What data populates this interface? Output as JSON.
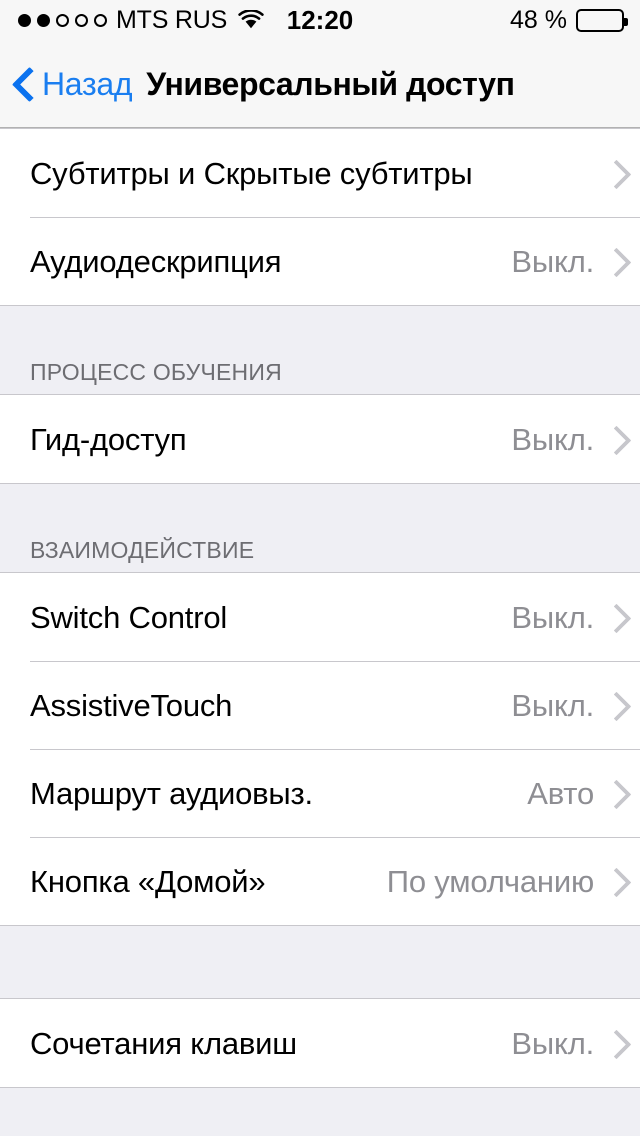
{
  "status_bar": {
    "signal_dots_total": 5,
    "signal_dots_filled": 2,
    "carrier": "MTS RUS",
    "wifi_icon": "wifi-icon",
    "time": "12:20",
    "battery_percent_label": "48 %",
    "battery_level": 48
  },
  "nav": {
    "back_label": "Назад",
    "back_icon": "chevron-left-icon",
    "title": "Универсальный доступ"
  },
  "colors": {
    "tint_blue": "#1a7ef0",
    "group_background": "#ffffff",
    "page_background": "#efeff4",
    "separator": "#c8c7cc",
    "value_gray": "#8e8e93",
    "header_gray": "#6d6d72",
    "chevron_gray": "#c7c7cc"
  },
  "groups": [
    {
      "header": null,
      "rows": [
        {
          "label": "Субтитры и Скрытые субтитры",
          "value": null,
          "accessory": "chevron-right-icon"
        },
        {
          "label": "Аудиодескрипция",
          "value": "Выкл.",
          "accessory": "chevron-right-icon"
        }
      ]
    },
    {
      "header": "ПРОЦЕСС ОБУЧЕНИЯ",
      "rows": [
        {
          "label": "Гид-доступ",
          "value": "Выкл.",
          "accessory": "chevron-right-icon"
        }
      ]
    },
    {
      "header": "ВЗАИМОДЕЙСТВИЕ",
      "rows": [
        {
          "label": "Switch Control",
          "value": "Выкл.",
          "accessory": "chevron-right-icon"
        },
        {
          "label": "AssistiveTouch",
          "value": "Выкл.",
          "accessory": "chevron-right-icon"
        },
        {
          "label": "Маршрут аудиовыз.",
          "value": "Авто",
          "accessory": "chevron-right-icon"
        },
        {
          "label": "Кнопка «Домой»",
          "value": "По умолчанию",
          "accessory": "chevron-right-icon"
        }
      ]
    },
    {
      "header": null,
      "rows": [
        {
          "label": "Сочетания клавиш",
          "value": "Выкл.",
          "accessory": "chevron-right-icon"
        }
      ]
    }
  ]
}
